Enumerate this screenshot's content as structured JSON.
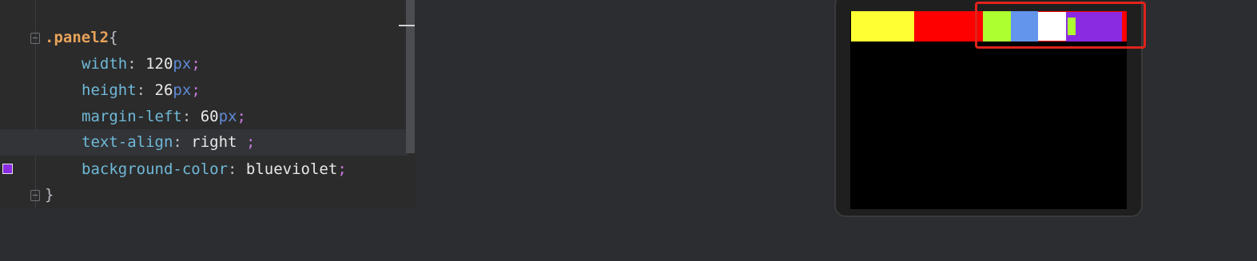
{
  "editor": {
    "lines": [
      {
        "selector": ".panel2",
        "brace": "{"
      },
      {
        "property": "width",
        "value": "120",
        "unit": "px"
      },
      {
        "property": "height",
        "value": "26",
        "unit": "px"
      },
      {
        "property": "margin-left",
        "value": "60",
        "unit": "px"
      },
      {
        "property": "text-align",
        "value": "right",
        "space": " "
      },
      {
        "property": "background-color",
        "value": "blueviolet"
      },
      {
        "close": "}"
      }
    ],
    "colon": ": ",
    "semicolon": ";"
  },
  "preview": {
    "colors": {
      "yellow": "#ffff33",
      "red": "#ff0000",
      "green_yellow": "#adff2f",
      "cornflower": "#6495ed",
      "white": "#ffffff",
      "blueviolet": "#8a2be2",
      "highlight": "#e0231b"
    }
  }
}
